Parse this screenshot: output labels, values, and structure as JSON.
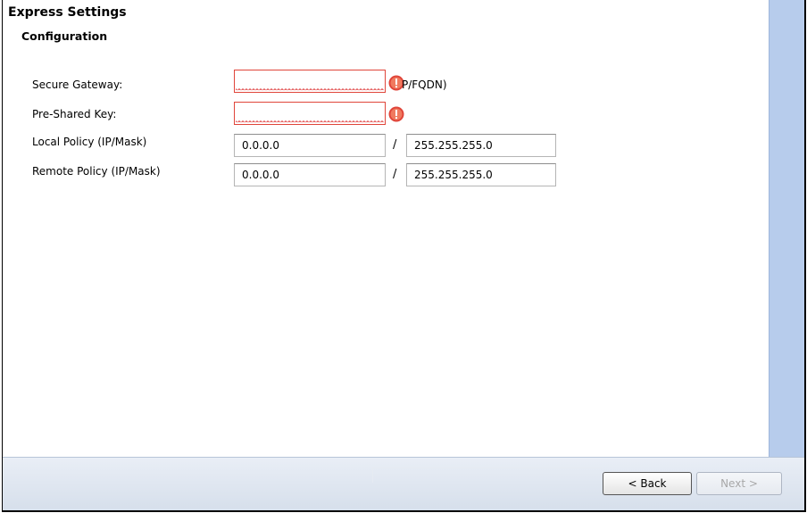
{
  "title": "Express Settings",
  "section_title": "Configuration",
  "fields": {
    "secure_gateway": {
      "label": "Secure Gateway:",
      "value": "",
      "hint": "P/FQDN)"
    },
    "pre_shared_key": {
      "label": "Pre-Shared Key:",
      "value": ""
    },
    "local_policy": {
      "label": "Local Policy (IP/Mask)",
      "ip": "0.0.0.0",
      "separator": "/",
      "mask": "255.255.255.0"
    },
    "remote_policy": {
      "label": "Remote Policy (IP/Mask)",
      "ip": "0.0.0.0",
      "separator": "/",
      "mask": "255.255.255.0"
    }
  },
  "buttons": {
    "back": "< Back",
    "next": "Next >"
  },
  "icons": {
    "error": "error-icon"
  },
  "colors": {
    "error_border": "#e0453a",
    "error_icon": "#e0453a",
    "side_panel": "#b7ccec"
  }
}
